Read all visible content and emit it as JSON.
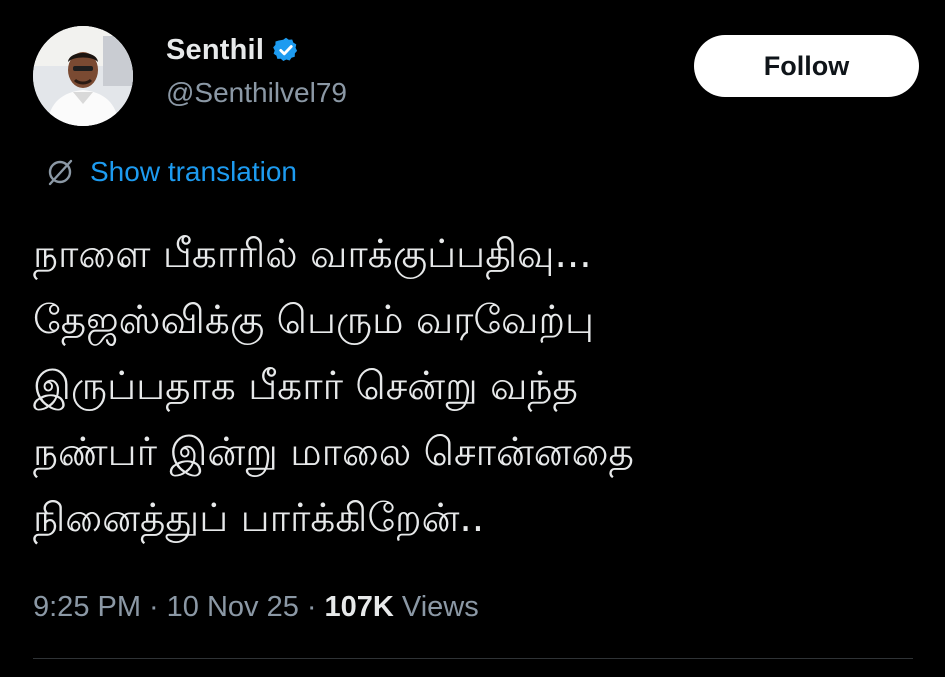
{
  "author": {
    "display_name": "Senthil",
    "handle": "@Senthilvel79",
    "verified": true,
    "verified_badge_color": "#1d9bf0",
    "avatar_icon": "profile-photo"
  },
  "actions": {
    "follow_label": "Follow"
  },
  "translation": {
    "icon": "globe-icon",
    "label": "Show translation",
    "link_color": "#1d9bf0"
  },
  "tweet": {
    "lines": [
      "நாளை பீகாரில் வாக்குப்பதிவு...",
      "தேஜஸ்விக்கு பெரும் வரவேற்பு",
      "இருப்பதாக பீகார் சென்று வந்த",
      "நண்பர் இன்று மாலை சொன்னதை",
      "நினைத்துப் பார்க்கிறேன்.."
    ]
  },
  "meta": {
    "time": "9:25 PM",
    "date": "10 Nov 25",
    "separator": "·",
    "views_count": "107K",
    "views_label": "Views"
  },
  "colors": {
    "background": "#000000",
    "text": "#e7e9ea",
    "secondary": "#8b98a5",
    "divider": "#2f3336"
  }
}
